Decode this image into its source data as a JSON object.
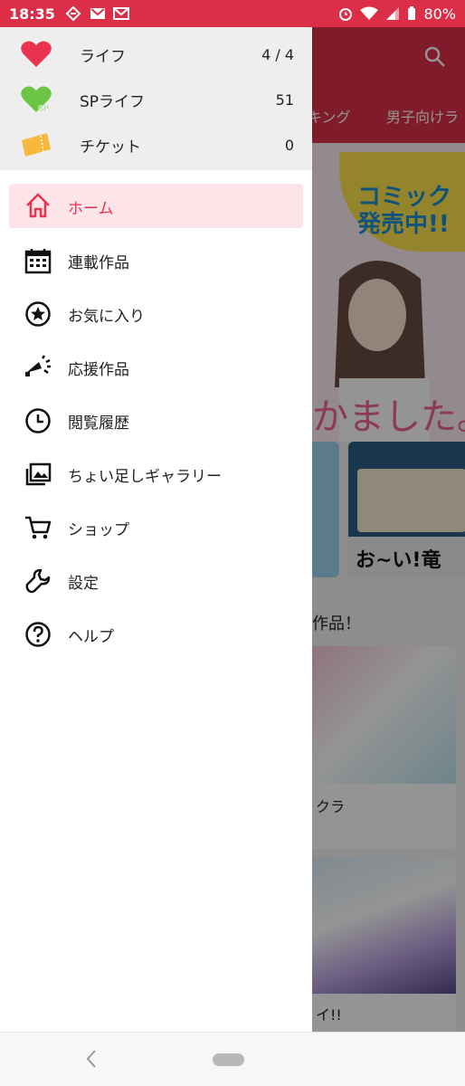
{
  "status_bar": {
    "time": "18:35",
    "battery": "80%"
  },
  "background_app": {
    "tabs": [
      "キング",
      "男子向けラ"
    ],
    "banner_text": "コミック\n発売中!!",
    "banner_tagline": "かました。",
    "promo_text": "お~い!竜",
    "section_title": "作品！",
    "card1_caption": "クラ",
    "card2_caption": "イ!!"
  },
  "drawer": {
    "header": [
      {
        "icon": "heart-icon",
        "label": "ライフ",
        "value": "4 / 4"
      },
      {
        "icon": "sp-heart-icon",
        "label": "SPライフ",
        "value": "51"
      },
      {
        "icon": "ticket-icon",
        "label": "チケット",
        "value": "0"
      }
    ],
    "menu": [
      {
        "icon": "home-icon",
        "label": "ホーム",
        "active": true
      },
      {
        "icon": "calendar-icon",
        "label": "連載作品"
      },
      {
        "icon": "star-icon",
        "label": "お気に入り"
      },
      {
        "icon": "cheer-icon",
        "label": "応援作品"
      },
      {
        "icon": "clock-icon",
        "label": "閲覧履歴"
      },
      {
        "icon": "gallery-icon",
        "label": "ちょい足しギャラリー"
      },
      {
        "icon": "cart-icon",
        "label": "ショップ"
      },
      {
        "icon": "wrench-icon",
        "label": "設定"
      },
      {
        "icon": "help-icon",
        "label": "ヘルプ"
      }
    ]
  },
  "colors": {
    "accent": "#e9334f",
    "status_bar": "#dc2f47",
    "active_bg": "#fde4e8",
    "sp_green": "#6cc644",
    "ticket": "#f6b93b"
  }
}
